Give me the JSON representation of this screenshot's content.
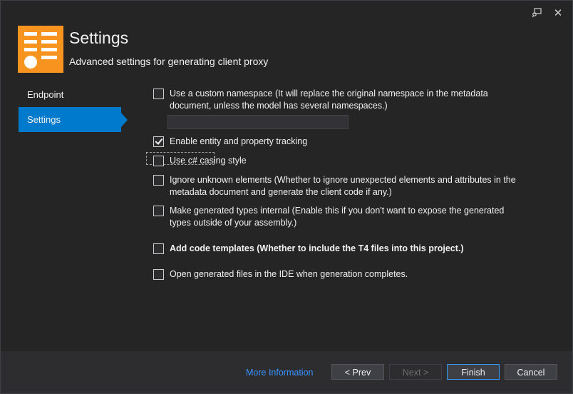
{
  "header": {
    "title": "Settings",
    "subtitle": "Advanced settings for generating client proxy",
    "logo_icon": "settings-list-icon",
    "accent_color": "#f79420"
  },
  "titlebar": {
    "feedback_icon": "feedback-icon",
    "close_glyph": "✕"
  },
  "sidebar": {
    "items": [
      {
        "label": "Endpoint",
        "selected": false
      },
      {
        "label": "Settings",
        "selected": true
      }
    ],
    "selected_color": "#007acc"
  },
  "options": {
    "custom_namespace": {
      "label": "Use a custom namespace (It will replace the original namespace in the metadata document, unless the model has several namespaces.)",
      "checked": false,
      "input_value": ""
    },
    "tracking": {
      "label": "Enable entity and property tracking",
      "checked": true
    },
    "casing": {
      "label": "Use c# casing style",
      "checked": false
    },
    "ignore_unknown": {
      "label": "Ignore unknown elements (Whether to ignore unexpected elements and attributes in the metadata document and generate the client code if any.)",
      "checked": false
    },
    "internal_types": {
      "label": "Make generated types internal (Enable this if you don't want to expose the generated types outside of your assembly.)",
      "checked": false
    },
    "code_templates": {
      "label": "Add code templates (Whether to include the T4 files into this project.)",
      "checked": false
    },
    "open_files": {
      "label": "Open generated files in the IDE when generation completes.",
      "checked": false
    }
  },
  "footer": {
    "more_info": "More Information",
    "prev": "< Prev",
    "next": "Next >",
    "finish": "Finish",
    "cancel": "Cancel"
  }
}
